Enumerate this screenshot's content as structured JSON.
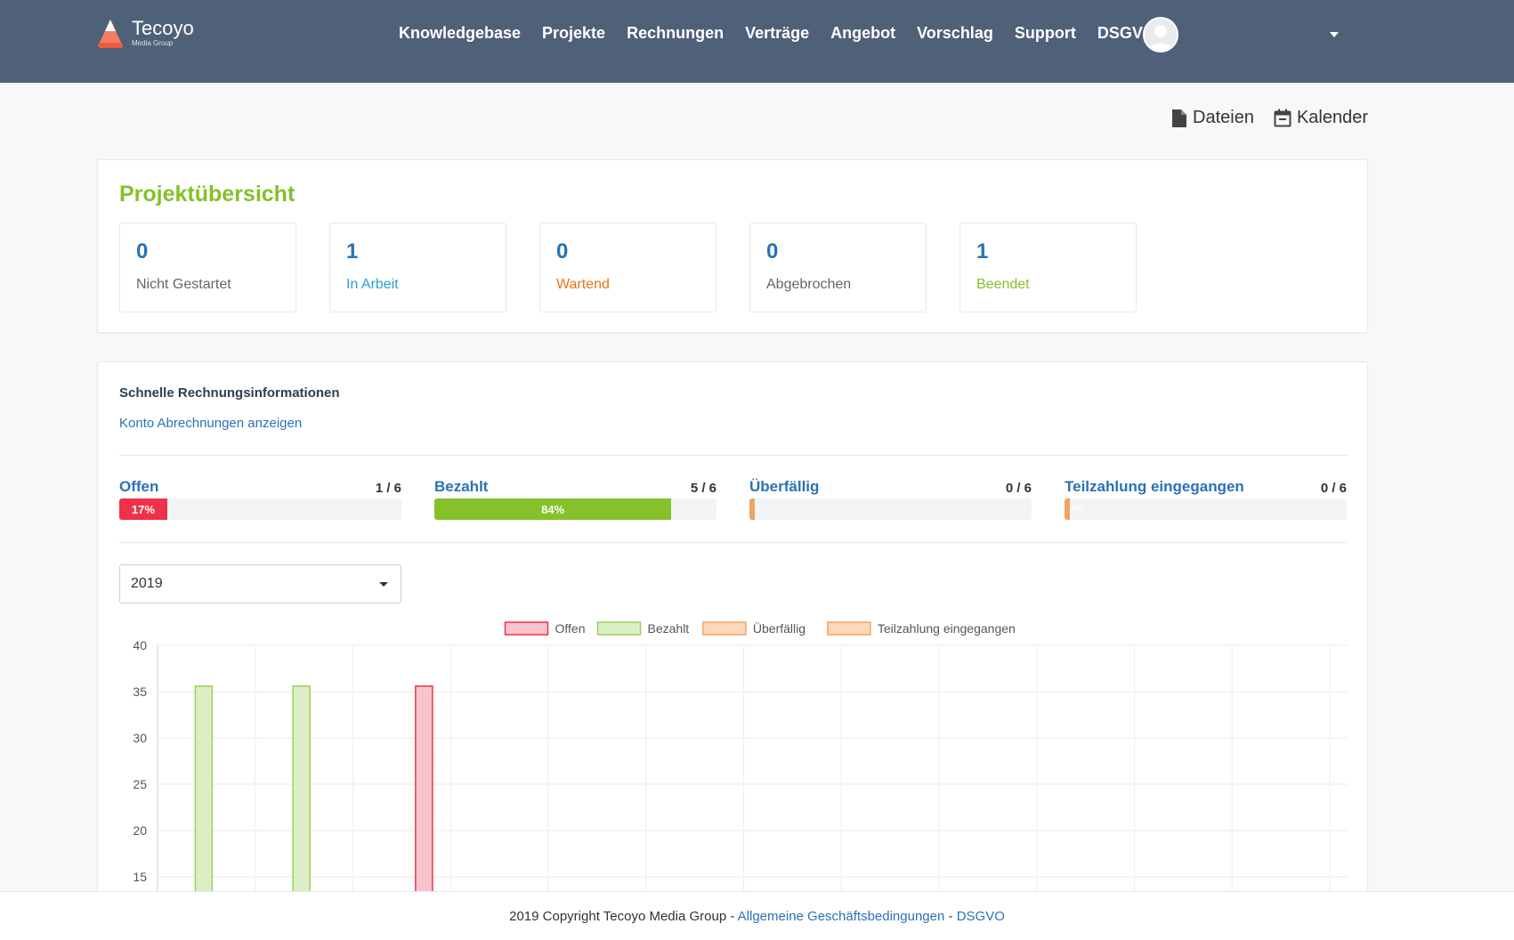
{
  "header": {
    "brand": "Tecoyo",
    "brand_sub": "Media Group",
    "nav": [
      "Knowledgebase",
      "Projekte",
      "Rechnungen",
      "Verträge",
      "Angebot",
      "Vorschlag",
      "Support",
      "DSGVO"
    ],
    "bg_color": "#4f6179"
  },
  "toplinks": {
    "files": "Dateien",
    "calendar": "Kalender"
  },
  "projects": {
    "title": "Projektübersicht",
    "stats": [
      {
        "value": "0",
        "label": "Nicht Gestartet",
        "color": "#666666"
      },
      {
        "value": "1",
        "label": "In Arbeit",
        "color": "#2a9fd6"
      },
      {
        "value": "0",
        "label": "Wartend",
        "color": "#f0720f"
      },
      {
        "value": "0",
        "label": "Abgebrochen",
        "color": "#666666"
      },
      {
        "value": "1",
        "label": "Beendet",
        "color": "#84c12a"
      }
    ]
  },
  "invoices": {
    "title": "Schnelle Rechnungsinformationen",
    "link": "Konto Abrechnungen anzeigen",
    "progress": [
      {
        "label": "Offen",
        "count": "1 / 6",
        "percent_text": "17%",
        "percent": 17,
        "color": "#f0314b"
      },
      {
        "label": "Bezahlt",
        "count": "5 / 6",
        "percent_text": "84%",
        "percent": 84,
        "color": "#84c12a"
      },
      {
        "label": "Überfällig",
        "count": "0 / 6",
        "percent_text": "0%",
        "percent": 0,
        "color": "#f4a261"
      },
      {
        "label": "Teilzahlung eingegangen",
        "count": "0 / 6",
        "percent_text": "0%",
        "percent": 0,
        "color": "#f4a261"
      }
    ],
    "year_select": "2019"
  },
  "chart_data": {
    "type": "bar",
    "legend": [
      {
        "name": "Offen",
        "fill": "#f9c4cc",
        "stroke": "#f0314b"
      },
      {
        "name": "Bezahlt",
        "fill": "#dcefc4",
        "stroke": "#9bd05a"
      },
      {
        "name": "Überfällig",
        "fill": "#fcd9b8",
        "stroke": "#f4a261"
      },
      {
        "name": "Teilzahlung eingegangen",
        "fill": "#fcd9b8",
        "stroke": "#f4a261"
      }
    ],
    "categories": 12,
    "series": [
      {
        "name": "Offen",
        "values": [
          0,
          0,
          35.6,
          0,
          0,
          0,
          0,
          0,
          0,
          0,
          0,
          0
        ]
      },
      {
        "name": "Bezahlt",
        "values": [
          35.6,
          35.6,
          0,
          0,
          0,
          0,
          0,
          0,
          0,
          0,
          0,
          0
        ]
      },
      {
        "name": "Überfällig",
        "values": [
          0,
          0,
          0,
          0,
          0,
          0,
          0,
          0,
          0,
          0,
          0,
          0
        ]
      },
      {
        "name": "Teilzahlung eingegangen",
        "values": [
          0,
          0,
          0,
          0,
          0,
          0,
          0,
          0,
          0,
          0,
          0,
          0
        ]
      }
    ],
    "yticks": [
      40,
      35,
      30,
      25,
      20,
      15
    ],
    "ylim": [
      0,
      40
    ],
    "grid": true,
    "legend_position": "top"
  },
  "footer": {
    "copyright": "2019 Copyright Tecoyo Media Group - ",
    "terms": "Allgemeine Geschäftsbedingungen",
    "sep": " - ",
    "dsgvo": "DSGVO"
  }
}
